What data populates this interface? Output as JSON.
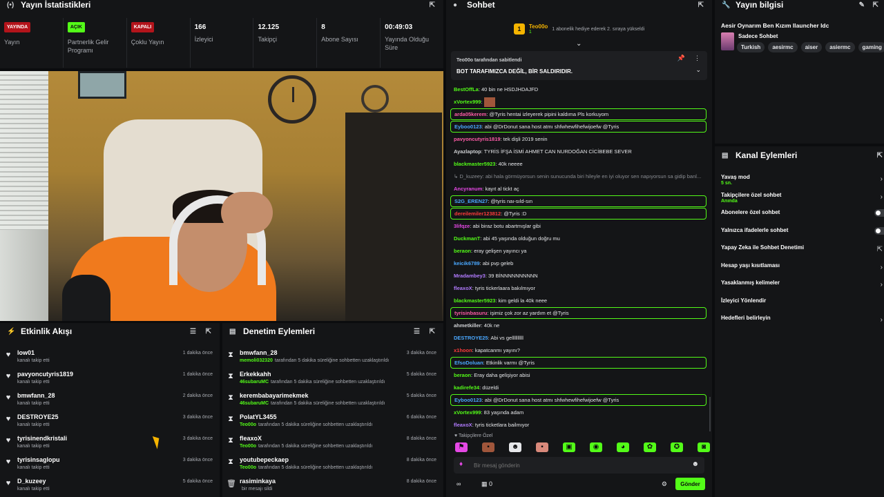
{
  "stats": {
    "title": "Yayın İstatistikleri",
    "items": [
      {
        "badge": "YAYINDA",
        "label": "Yayın"
      },
      {
        "badge": "AÇIK",
        "label": "Partnerlik Gelir Programı"
      },
      {
        "badge": "KAPALI",
        "label": "Çoklu Yayın"
      },
      {
        "value": "166",
        "label": "İzleyici"
      },
      {
        "value": "12.125",
        "label": "Takipçi"
      },
      {
        "value": "8",
        "label": "Abone Sayısı"
      },
      {
        "value": "00:49:03",
        "label": "Yayında Olduğu Süre"
      }
    ]
  },
  "events": {
    "title": "Etkinlik Akışı",
    "items": [
      {
        "name": "low01",
        "sub": "kanalı takip etti",
        "time": "1 dakika önce"
      },
      {
        "name": "pavyoncutyris1819",
        "sub": "kanalı takip etti",
        "time": "1 dakika önce"
      },
      {
        "name": "bmwfann_28",
        "sub": "kanalı takip etti",
        "time": "2 dakika önce"
      },
      {
        "name": "DESTROYE25",
        "sub": "kanalı takip etti",
        "time": "3 dakika önce"
      },
      {
        "name": "tyrisinendkristali",
        "sub": "kanalı takip etti",
        "time": "3 dakika önce"
      },
      {
        "name": "tyrisinsaglopu",
        "sub": "kanalı takip etti",
        "time": "3 dakika önce"
      },
      {
        "name": "D_kuzeey",
        "sub": "kanalı takip etti",
        "time": "5 dakika önce"
      }
    ]
  },
  "moderation": {
    "title": "Denetim Eylemleri",
    "items": [
      {
        "name": "bmwfann_28",
        "actor": "memoli032320",
        "sub": "tarafından 5 dakika süreliğine sohbetten uzaklaştırıldı",
        "time": "3 dakika önce"
      },
      {
        "name": "Erkekkahh",
        "actor": "46subaruMC",
        "sub": "tarafından 5 dakika süreliğine sohbetten uzaklaştırıldı",
        "time": "5 dakika önce"
      },
      {
        "name": "kerembabayarimekmek",
        "actor": "46subaruMC",
        "sub": "tarafından 5 dakika süreliğine sohbetten uzaklaştırıldı",
        "time": "5 dakika önce"
      },
      {
        "name": "PolatYL3455",
        "actor": "Teo00o",
        "sub": "tarafından 5 dakika süreliğine sohbetten uzaklaştırıldı",
        "time": "6 dakika önce"
      },
      {
        "name": "fleaxoX",
        "actor": "Teo00o",
        "sub": "tarafından 5 dakika süreliğine sohbetten uzaklaştırıldı",
        "time": "8 dakika önce"
      },
      {
        "name": "youtubepeckaep",
        "actor": "Teo00o",
        "sub": "tarafından 5 dakika süreliğine sohbetten uzaklaştırıldı",
        "time": "8 dakika önce"
      },
      {
        "name": "rasiminkaya",
        "actor": "",
        "sub": "bir mesajı sildi",
        "time": "8 dakika önce"
      }
    ]
  },
  "chat": {
    "title": "Sohbet",
    "host_name": "Teo00o",
    "host_count": "1",
    "host_msg": "1 abonelik hediye ederek 2. sıraya yükseldi",
    "pinned_by": "Teo00o tarafından sabitlendi",
    "pinned_text": "BOT TARAFIMIZCA DEĞİL, BİR SALDIRIDIR.",
    "messages": [
      {
        "user": "BestOffLa",
        "color": "#53fc18",
        "text": "40 bin ne HSDJHDAJFD",
        "hl": false
      },
      {
        "user": "xVortex999",
        "color": "#53fc18",
        "text": "",
        "img": true,
        "hl": false
      },
      {
        "user": "arda05kerem",
        "color": "#ff5ca8",
        "text": "@Tyris hentai izleyerek pipini kaldıma Pls korkuyom",
        "hl": true
      },
      {
        "user": "Eyboo0123",
        "color": "#4aa8ff",
        "text": "abi @DrDonut sana host atmı shfwhewfihefwijoefw @Tyris",
        "hl": true
      },
      {
        "user": "pavyoncutyris1819",
        "color": "#ff5ca8",
        "text": "tek dişli 2019 senin",
        "hl": false
      },
      {
        "user": "Ayazlaptop",
        "color": "#cfd1d4",
        "text": "TYRİS İFŞA İSMİ AHMET CAN NURDOĞAN CİCİBEBE SEVER",
        "hl": false
      },
      {
        "user": "blackmaster5923",
        "color": "#53fc18",
        "text": "40k neeee",
        "hl": false
      },
      {
        "user": "",
        "color": "#8a8d93",
        "text": "↳ D_kuzeey: abi hala görmüyorsun senin sunucunda biri hileyle en iyi oluyor sen napıyorsun sa gidip banl...",
        "reply": true,
        "hl": false
      },
      {
        "user": "Ancyranum",
        "color": "#e548e5",
        "text": "kayıt al tickt aç",
        "hl": false
      },
      {
        "user": "S2G_EREN27",
        "color": "#4aa8ff",
        "text": "@tyris naı-sıld-sın",
        "hl": true
      },
      {
        "user": "dereilemiler123812",
        "color": "#ff3b3b",
        "text": "@Tyris :D",
        "hl": true
      },
      {
        "user": "3lifqze",
        "color": "#e548e5",
        "text": "abi biraz botu abartmışlar gibi",
        "hl": false
      },
      {
        "user": "DuckmanT",
        "color": "#53fc18",
        "text": "abi 45 yaşında olduğun doğru mu",
        "hl": false
      },
      {
        "user": "beraon",
        "color": "#53fc18",
        "text": "eray gelişen yayıncı ya",
        "hl": false
      },
      {
        "user": "keicik6789",
        "color": "#4aa8ff",
        "text": "abi pvp geleb",
        "hl": false
      },
      {
        "user": "Mradambey3",
        "color": "#b27bff",
        "text": "39 BİNNNNNNNNNN",
        "hl": false
      },
      {
        "user": "fleaxoX",
        "color": "#b27bff",
        "text": "tyris tickerlaara bakılmıyor",
        "hl": false
      },
      {
        "user": "blackmaster5923",
        "color": "#53fc18",
        "text": "kim geldi la 40k neee",
        "hl": false
      },
      {
        "user": "tyrisinbasuru",
        "color": "#ff5ca8",
        "text": "işimiz çok zor az yardım et @Tyris",
        "hl": true
      },
      {
        "user": "ahmetkiller",
        "color": "#cfd1d4",
        "text": "40k ne",
        "hl": false
      },
      {
        "user": "DESTROYE25",
        "color": "#4aa8ff",
        "text": "Abi vs gellllllllll",
        "hl": false
      },
      {
        "user": "x1hoon",
        "color": "#ff3b3b",
        "text": "kapatcanmı yayını?",
        "hl": false
      },
      {
        "user": "EfsoDoluan",
        "color": "#4aa8ff",
        "text": "Etkinlik varmı @Tyris",
        "hl": true
      },
      {
        "user": "beraon",
        "color": "#53fc18",
        "text": "Eray daha gelişiyor abisi",
        "hl": false
      },
      {
        "user": "kadirefe34",
        "color": "#53fc18",
        "text": "düzeldi",
        "hl": false
      },
      {
        "user": "Eyboo0123",
        "color": "#4aa8ff",
        "text": "abi @DrDonut sana host atmı shfwhewfihefwijoefw @Tyris",
        "hl": true
      },
      {
        "user": "xVortex999",
        "color": "#53fc18",
        "text": "83 yaşında adam",
        "hl": false
      },
      {
        "user": "fleaxoX",
        "color": "#b27bff",
        "text": "tyris ticketlara bailmıyor",
        "hl": false
      }
    ],
    "sub_only": "♥ Takipçilere Özel",
    "emotes": [
      {
        "icon": "⚑",
        "color": "#e548e5"
      },
      {
        "icon": "▪",
        "color": "#a0563b"
      },
      {
        "icon": "☻",
        "color": "#e6e7ea"
      },
      {
        "icon": "▪",
        "color": "#d9897b"
      },
      {
        "icon": "▣",
        "color": "#53fc18"
      },
      {
        "icon": "◉",
        "color": "#53fc18"
      },
      {
        "icon": "◕",
        "color": "#53fc18"
      },
      {
        "icon": "✿",
        "color": "#53fc18"
      },
      {
        "icon": "✪",
        "color": "#53fc18"
      },
      {
        "icon": "◙",
        "color": "#53fc18"
      }
    ],
    "input_placeholder": "Bir mesaj gönderin",
    "infinity_label": "∞",
    "points_label": "0",
    "send_label": "Gönder"
  },
  "info": {
    "title": "Yayın bilgisi",
    "stream_title": "Aesir Oynarım Ben Kızım llauncher ldc",
    "category": "Sadece Sohbet",
    "tags": [
      "Turkish",
      "aesirmc",
      "aiser",
      "asiermc",
      "gaming"
    ]
  },
  "actions": {
    "title": "Kanal Eylemleri",
    "items": [
      {
        "name": "Yavaş mod",
        "sub": "5 sn.",
        "control": "chevron"
      },
      {
        "name": "Takipçilere özel sohbet",
        "sub": "Anında",
        "control": "chevron"
      },
      {
        "name": "Abonelere özel sohbet",
        "sub": "",
        "control": "toggle"
      },
      {
        "name": "Yalnızca ifadelerle sohbet",
        "sub": "",
        "control": "toggle"
      },
      {
        "name": "Yapay Zeka ile Sohbet Denetimi",
        "sub": "",
        "control": "external"
      },
      {
        "name": "Hesap yaşı kısıtlaması",
        "sub": "",
        "control": "chevron"
      },
      {
        "name": "Yasaklanmış kelimeler",
        "sub": "",
        "control": "chevron"
      },
      {
        "name": "İzleyici Yönlendir",
        "sub": "",
        "control": "none"
      },
      {
        "name": "Hedefleri belirleyin",
        "sub": "",
        "control": "chevron"
      }
    ]
  },
  "colors": {
    "accent": "#53fc18",
    "live": "#b3141b",
    "panel": "#141517"
  }
}
